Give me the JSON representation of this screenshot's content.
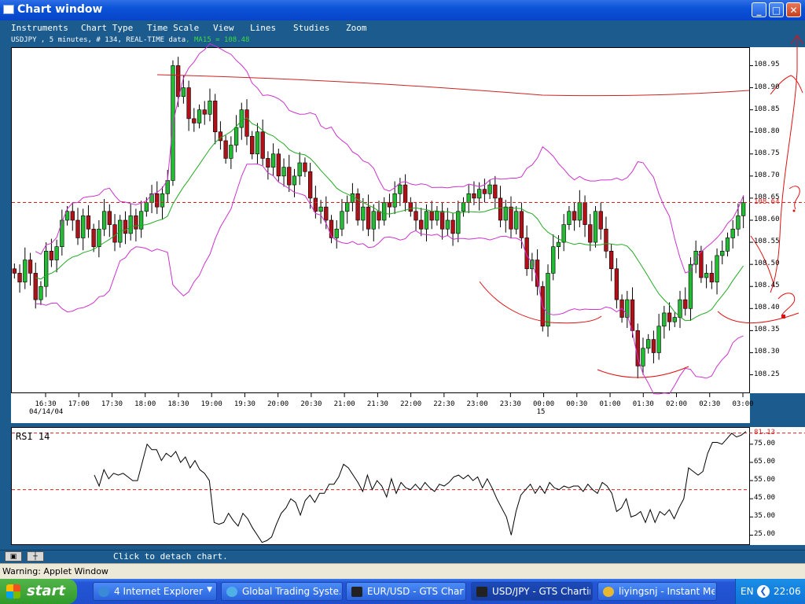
{
  "window": {
    "title": "Chart window"
  },
  "menu": [
    "Instruments",
    "Chart Type",
    "Time Scale",
    "View",
    "Lines",
    "Studies",
    "Zoom"
  ],
  "legend": {
    "symbol_info": "USDJPY , 5 minutes, # 134, REAL-TIME data",
    "ma_label": ", MA15 = 108.48"
  },
  "status": {
    "detach": "Click to detach chart.",
    "warning": "Warning: Applet Window"
  },
  "taskbar": {
    "start": "start",
    "tasks": [
      {
        "label": "4 Internet Explorer",
        "icon": "ie-icon"
      },
      {
        "label": "Global Trading Syste...",
        "icon": "globe-icon"
      },
      {
        "label": "EUR/USD - GTS Chart...",
        "icon": "chart-icon"
      },
      {
        "label": "USD/JPY - GTS Charting",
        "icon": "chart-icon"
      },
      {
        "label": "liyingsnj - Instant Me...",
        "icon": "messenger-icon"
      }
    ],
    "lang": "EN",
    "clock": "22:06"
  },
  "chart_data": [
    {
      "type": "candlestick",
      "ylim": [
        108.21,
        108.99
      ],
      "yticks": [
        "108.95",
        "108.90",
        "108.85",
        "108.80",
        "108.75",
        "108.70",
        "108.65",
        "108.60",
        "108.55",
        "108.50",
        "108.45",
        "108.40",
        "108.35",
        "108.30",
        "108.25"
      ],
      "current_price_label": "108.64",
      "xticks": [
        "16:30",
        "17:00",
        "17:30",
        "18:00",
        "18:30",
        "19:00",
        "19:30",
        "20:00",
        "20:30",
        "21:00",
        "21:30",
        "22:00",
        "22:30",
        "23:00",
        "23:30",
        "00:00",
        "00:30",
        "01:00",
        "01:30",
        "02:00",
        "02:30",
        "03:00"
      ],
      "date_labels": {
        "first": "04/14/04",
        "day": "15"
      },
      "close": [
        108.48,
        108.46,
        108.51,
        108.48,
        108.42,
        108.45,
        108.53,
        108.51,
        108.54,
        108.6,
        108.62,
        108.6,
        108.56,
        108.61,
        108.58,
        108.54,
        108.58,
        108.62,
        108.59,
        108.55,
        108.6,
        108.57,
        108.61,
        108.58,
        108.62,
        108.64,
        108.66,
        108.63,
        108.66,
        108.69,
        108.95,
        108.88,
        108.9,
        108.83,
        108.82,
        108.85,
        108.84,
        108.87,
        108.8,
        108.78,
        108.74,
        108.77,
        108.81,
        108.85,
        108.79,
        108.75,
        108.8,
        108.74,
        108.72,
        108.75,
        108.7,
        108.72,
        108.68,
        108.7,
        108.73,
        108.71,
        108.65,
        108.62,
        108.63,
        108.6,
        108.56,
        108.58,
        108.62,
        108.64,
        108.66,
        108.6,
        108.63,
        108.58,
        108.62,
        108.6,
        108.64,
        108.63,
        108.66,
        108.68,
        108.64,
        108.62,
        108.6,
        108.58,
        108.62,
        108.6,
        108.62,
        108.58,
        108.6,
        108.57,
        108.62,
        108.64,
        108.66,
        108.65,
        108.67,
        108.66,
        108.68,
        108.65,
        108.6,
        108.63,
        108.58,
        108.62,
        108.56,
        108.49,
        108.51,
        108.45,
        108.36,
        108.48,
        108.54,
        108.55,
        108.59,
        108.62,
        108.6,
        108.64,
        108.59,
        108.55,
        108.62,
        108.58,
        108.53,
        108.49,
        108.42,
        108.38,
        108.42,
        108.35,
        108.27,
        108.31,
        108.33,
        108.3,
        108.36,
        108.39,
        108.37,
        108.38,
        108.42,
        108.4,
        108.5,
        108.53,
        108.47,
        108.48,
        108.46,
        108.52,
        108.53,
        108.56,
        108.58,
        108.61,
        108.64
      ]
    },
    {
      "type": "line",
      "title": "RSI 14",
      "ylim": [
        20,
        84
      ],
      "yticks": [
        "75.00",
        "65.00",
        "55.00",
        "45.00",
        "35.00",
        "25.00"
      ],
      "levels": {
        "upper": 81.13,
        "lower": 50
      },
      "upper_label": "81.13",
      "values": [
        58,
        52,
        61,
        56,
        59,
        58,
        59,
        57,
        55,
        55,
        65,
        75,
        72,
        72,
        66,
        70,
        68,
        71,
        65,
        68,
        62,
        66,
        61,
        59,
        55,
        32,
        31,
        32,
        37,
        33,
        30,
        37,
        34,
        29,
        25,
        21,
        22,
        24,
        31,
        37,
        40,
        45,
        43,
        36,
        44,
        47,
        43,
        48,
        48,
        53,
        53,
        57,
        64,
        62,
        58,
        54,
        49,
        58,
        50,
        55,
        52,
        46,
        56,
        48,
        54,
        51,
        50,
        53,
        50,
        54,
        51,
        49,
        53,
        52,
        54,
        57,
        58,
        56,
        58,
        55,
        57,
        51,
        56,
        51,
        45,
        40,
        35,
        25,
        38,
        47,
        50,
        53,
        48,
        52,
        48,
        54,
        51,
        50,
        52,
        51,
        52,
        52,
        49,
        53,
        50,
        48,
        54,
        52,
        48,
        38,
        40,
        45,
        35,
        36,
        38,
        32,
        39,
        32,
        38,
        36,
        39,
        34,
        40,
        45,
        62,
        60,
        58,
        60,
        70,
        76,
        76,
        75,
        78,
        81,
        79,
        80,
        82
      ]
    }
  ]
}
